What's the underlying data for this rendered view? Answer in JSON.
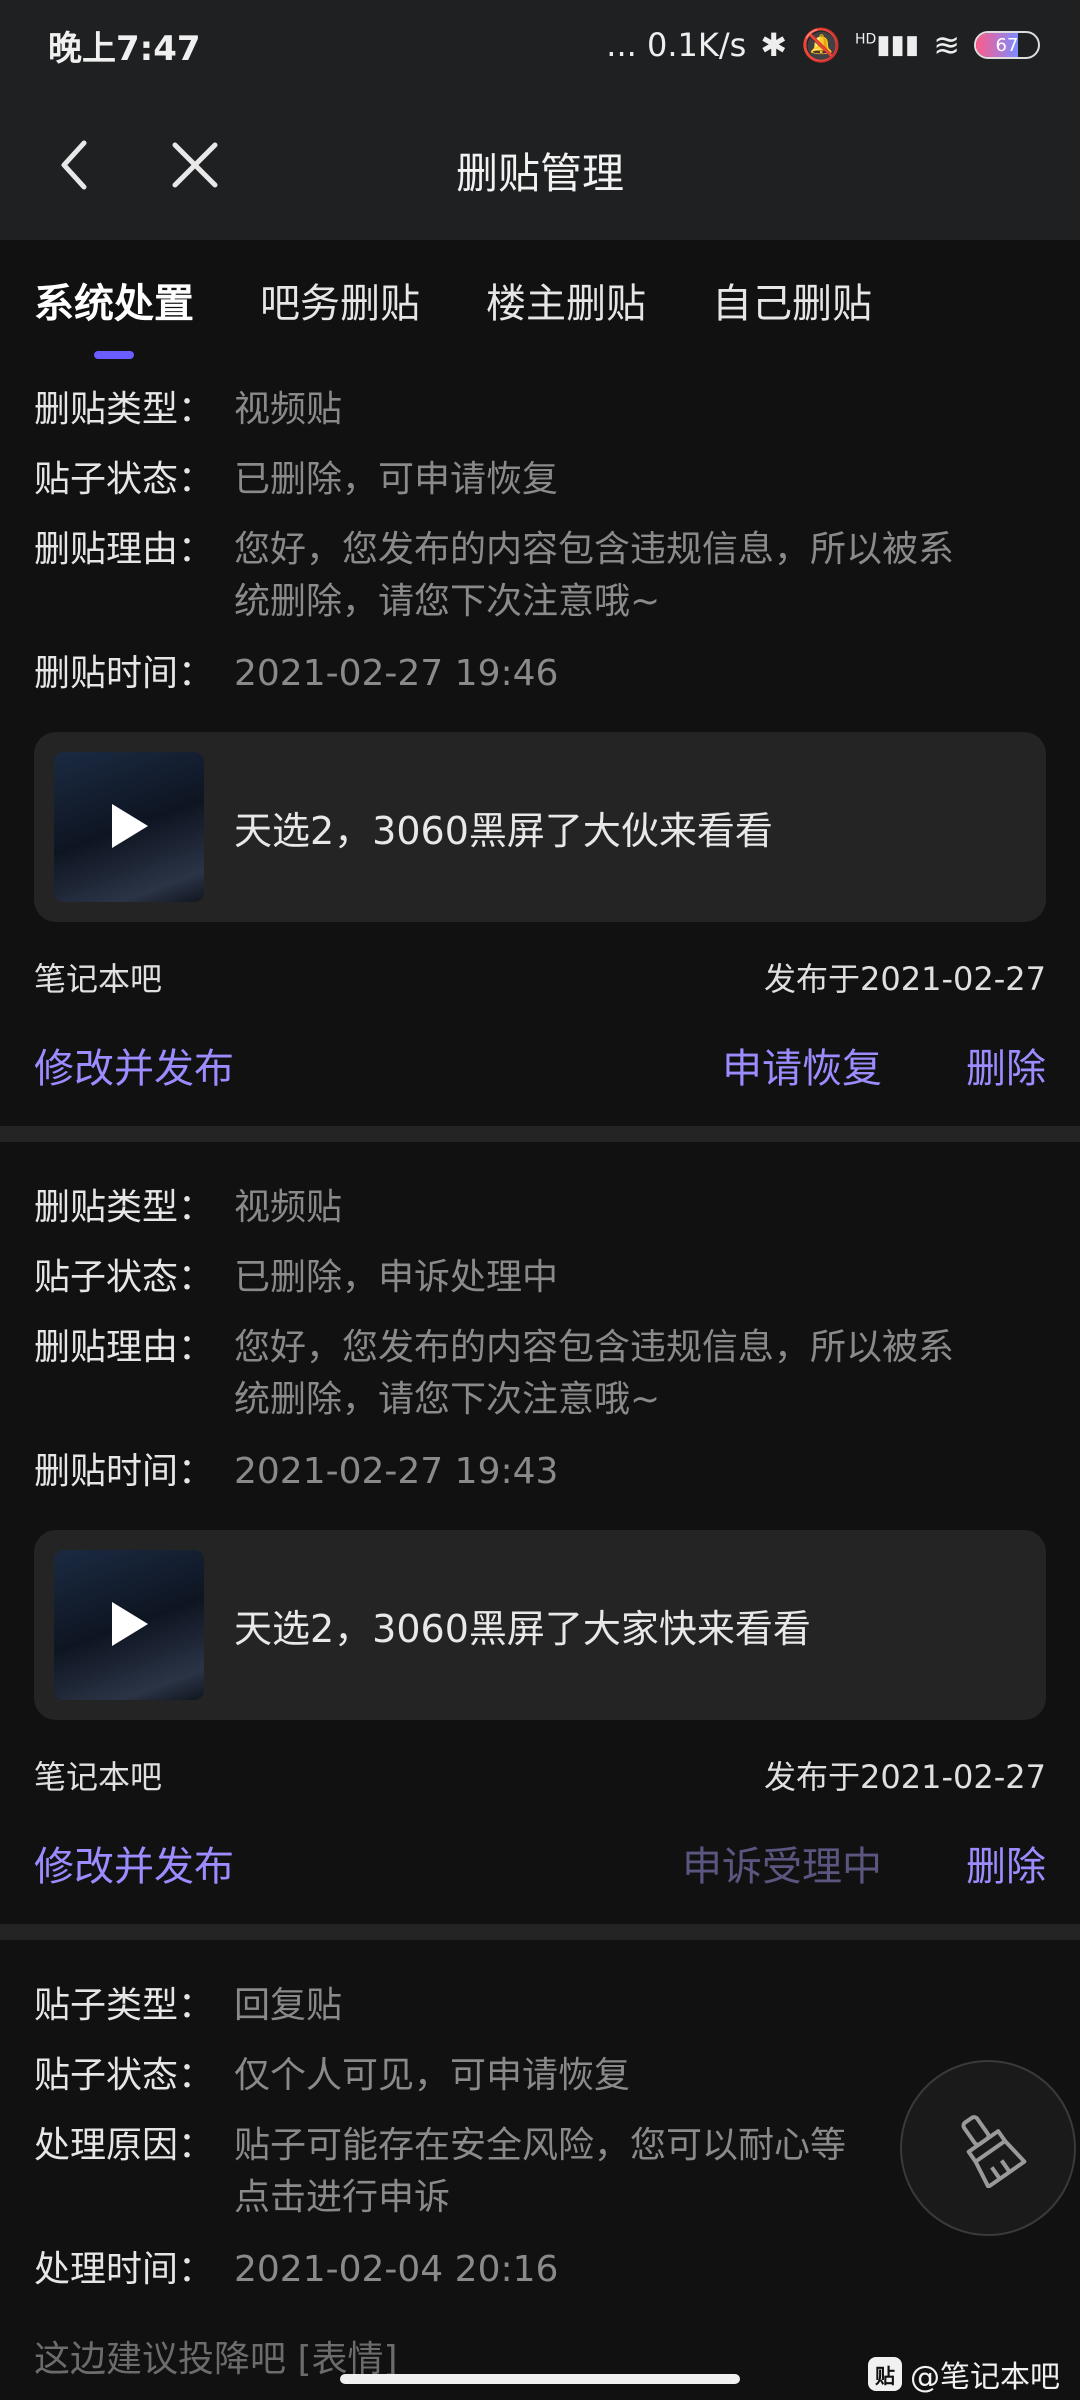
{
  "status_bar": {
    "time": "晚上7:47",
    "net_speed": "... 0.1K/s",
    "signal_badge": "HD",
    "battery": "67"
  },
  "header": {
    "title": "删贴管理"
  },
  "tabs": [
    {
      "label": "系统处置",
      "active": true
    },
    {
      "label": "吧务删贴",
      "active": false
    },
    {
      "label": "楼主删贴",
      "active": false
    },
    {
      "label": "自己删贴",
      "active": false
    }
  ],
  "records": [
    {
      "labels": [
        "删贴类型：",
        "贴子状态：",
        "删贴理由：",
        "删贴时间："
      ],
      "type": "视频贴",
      "status": "已删除，可申请恢复",
      "reason_line1": "您好，您发布的内容包含违规信息，所以被系",
      "reason_line2": "统删除，请您下次注意哦~",
      "time": "2021-02-27 19:46",
      "post_title": "天选2，3060黑屏了大伙来看看",
      "forum": "笔记本吧",
      "published": "发布于2021-02-27",
      "action_edit": "修改并发布",
      "action_mid": "申请恢复",
      "action_delete": "删除"
    },
    {
      "labels": [
        "删贴类型：",
        "贴子状态：",
        "删贴理由：",
        "删贴时间："
      ],
      "type": "视频贴",
      "status": "已删除，申诉处理中",
      "reason_line1": "您好，您发布的内容包含违规信息，所以被系",
      "reason_line2": "统删除，请您下次注意哦~",
      "time": "2021-02-27 19:43",
      "post_title": "天选2，3060黑屏了大家快来看看",
      "forum": "笔记本吧",
      "published": "发布于2021-02-27",
      "action_edit": "修改并发布",
      "action_mid": "申诉受理中",
      "action_delete": "删除"
    },
    {
      "labels": [
        "贴子类型：",
        "贴子状态：",
        "处理原因：",
        "处理时间："
      ],
      "type": "回复贴",
      "status": "仅个人可见，可申请恢复",
      "reason_line1": "贴子可能存在安全风险，您可以耐心等",
      "reason_line2": "点击进行申诉",
      "time": "2021-02-04 20:16",
      "preview": "这边建议投降吧 [表情]"
    }
  ],
  "watermark": {
    "logo": "贴",
    "text": "@笔记本吧"
  },
  "fab_icon": "brush-icon"
}
